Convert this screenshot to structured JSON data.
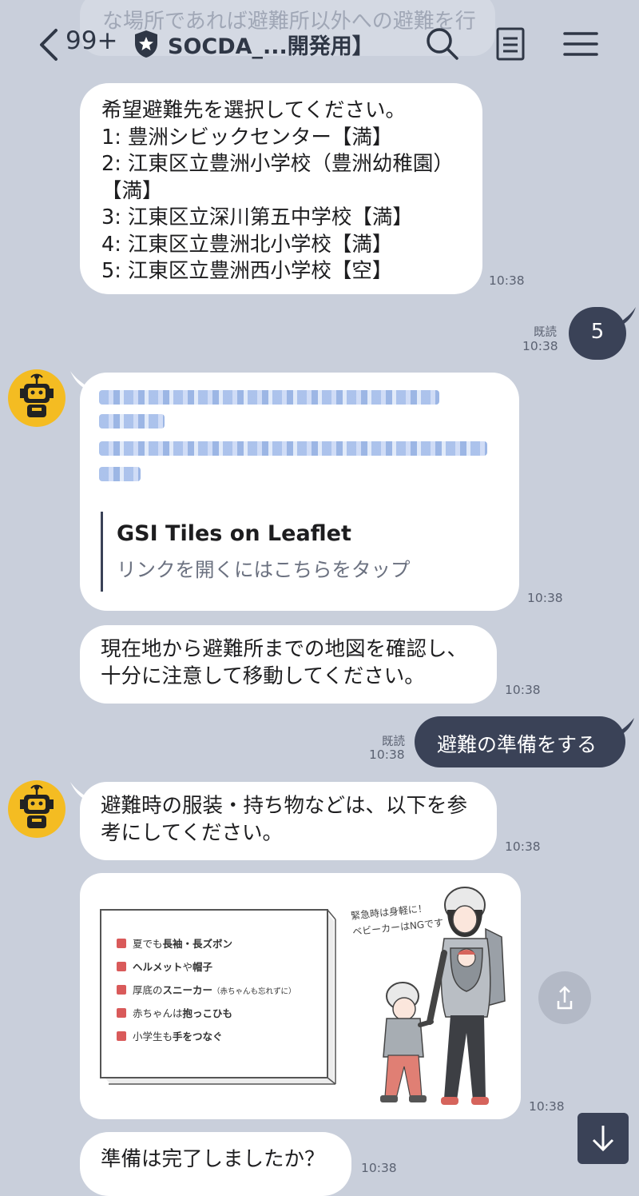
{
  "header": {
    "ghost_text": "な場所であれば避難所以外への避難を行",
    "unread_count": "99+",
    "chat_title": "SOCDA_...開発用】",
    "icons": [
      "back-arrow-icon",
      "shield-icon",
      "search-icon",
      "notes-icon",
      "menu-icon"
    ]
  },
  "messages": {
    "m1": {
      "lines": "希望避難先を選択してください。\n1: 豊洲シビックセンター【満】\n2: 江東区立豊洲小学校（豊洲幼稚園）\n【満】\n3: 江東区立深川第五中学校【満】\n4: 江東区立豊洲北小学校【満】\n5: 江東区立豊洲西小学校【空】",
      "time": "10:38"
    },
    "m2": {
      "text": "5",
      "read": "既読",
      "time": "10:38"
    },
    "m3": {
      "link_title": "GSI Tiles on Leaflet",
      "link_subtitle": "リンクを開くにはこちらをタップ",
      "time": "10:38"
    },
    "m4": {
      "lines": "現在地から避難所までの地図を確認し、\n十分に注意して移動してください。",
      "time": "10:38"
    },
    "m5": {
      "text": "避難の準備をする",
      "read": "既読",
      "time": "10:38"
    },
    "m6": {
      "lines": "避難時の服装・持ち物などは、以下を参\n考にしてください。",
      "time": "10:38"
    },
    "m7": {
      "items": [
        {
          "pre": "夏でも",
          "bold": "長袖・長ズボン",
          "post": ""
        },
        {
          "pre": "",
          "bold": "ヘルメット",
          "post": "や",
          "bold2": "帽子"
        },
        {
          "pre": "厚底の",
          "bold": "スニーカー",
          "post": "（赤ちゃんも忘れずに）"
        },
        {
          "pre": "赤ちゃんは",
          "bold": "抱っこひも",
          "post": ""
        },
        {
          "pre": "小学生も",
          "bold": "手をつなぐ",
          "post": ""
        }
      ],
      "note": "緊急時は身軽に！\nベビーカーはNGです",
      "time": "10:38"
    },
    "m8": {
      "lines": "準備は完了しましたか？",
      "time": "10:38"
    }
  },
  "colors": {
    "background": "#c9cfdb",
    "sent_bubble": "#3a4257",
    "received_bubble": "#ffffff",
    "avatar": "#f4bc22",
    "check": "#d95a5a"
  }
}
